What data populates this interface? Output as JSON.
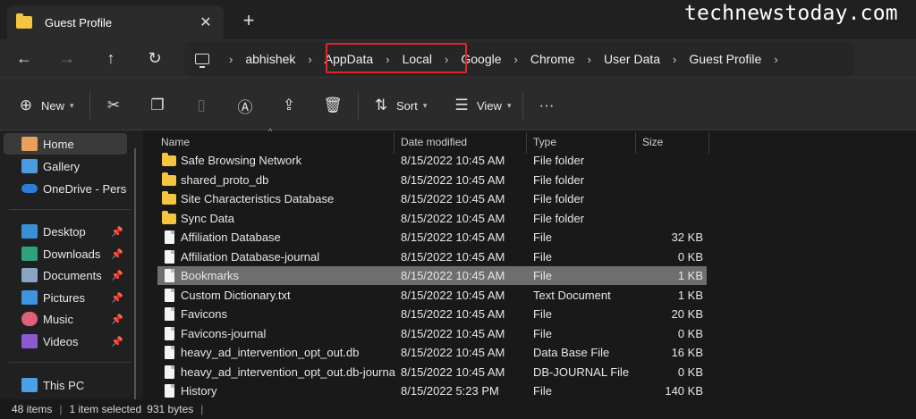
{
  "tab": {
    "title": "Guest Profile",
    "close": "✕",
    "new_tab": "+"
  },
  "watermark": "technewstoday.com",
  "nav": {
    "back": "←",
    "forward": "→",
    "up": "↑",
    "refresh": "↻"
  },
  "breadcrumbs": [
    "abhishek",
    "AppData",
    "Local",
    "Google",
    "Chrome",
    "User Data",
    "Guest Profile"
  ],
  "breadcrumb_sep": "›",
  "highlight_color": "#e0252b",
  "commands": {
    "new_label": "New",
    "sort_label": "Sort",
    "view_label": "View",
    "more": "···"
  },
  "sidebar": {
    "items": [
      {
        "label": "Home",
        "icon": "home-icon"
      },
      {
        "label": "Gallery",
        "icon": "gallery-icon"
      },
      {
        "label": "OneDrive - Person",
        "icon": "onedrive-icon"
      },
      {
        "label": "Desktop",
        "icon": "desktop-icon"
      },
      {
        "label": "Downloads",
        "icon": "downloads-icon"
      },
      {
        "label": "Documents",
        "icon": "documents-icon"
      },
      {
        "label": "Pictures",
        "icon": "pictures-icon"
      },
      {
        "label": "Music",
        "icon": "music-icon"
      },
      {
        "label": "Videos",
        "icon": "videos-icon"
      },
      {
        "label": "This PC",
        "icon": "this-pc-icon"
      }
    ]
  },
  "columns": {
    "name": "Name",
    "date": "Date modified",
    "type": "Type",
    "size": "Size"
  },
  "files": [
    {
      "name": "Safe Browsing Network",
      "date": "8/15/2022 10:45 AM",
      "type": "File folder",
      "size": "",
      "kind": "folder"
    },
    {
      "name": "shared_proto_db",
      "date": "8/15/2022 10:45 AM",
      "type": "File folder",
      "size": "",
      "kind": "folder"
    },
    {
      "name": "Site Characteristics Database",
      "date": "8/15/2022 10:45 AM",
      "type": "File folder",
      "size": "",
      "kind": "folder"
    },
    {
      "name": "Sync Data",
      "date": "8/15/2022 10:45 AM",
      "type": "File folder",
      "size": "",
      "kind": "folder"
    },
    {
      "name": "Affiliation Database",
      "date": "8/15/2022 10:45 AM",
      "type": "File",
      "size": "32 KB",
      "kind": "file"
    },
    {
      "name": "Affiliation Database-journal",
      "date": "8/15/2022 10:45 AM",
      "type": "File",
      "size": "0 KB",
      "kind": "file"
    },
    {
      "name": "Bookmarks",
      "date": "8/15/2022 10:45 AM",
      "type": "File",
      "size": "1 KB",
      "kind": "file",
      "selected": true
    },
    {
      "name": "Custom Dictionary.txt",
      "date": "8/15/2022 10:45 AM",
      "type": "Text Document",
      "size": "1 KB",
      "kind": "file"
    },
    {
      "name": "Favicons",
      "date": "8/15/2022 10:45 AM",
      "type": "File",
      "size": "20 KB",
      "kind": "file"
    },
    {
      "name": "Favicons-journal",
      "date": "8/15/2022 10:45 AM",
      "type": "File",
      "size": "0 KB",
      "kind": "file"
    },
    {
      "name": "heavy_ad_intervention_opt_out.db",
      "date": "8/15/2022 10:45 AM",
      "type": "Data Base File",
      "size": "16 KB",
      "kind": "file"
    },
    {
      "name": "heavy_ad_intervention_opt_out.db-journal",
      "date": "8/15/2022 10:45 AM",
      "type": "DB-JOURNAL File",
      "size": "0 KB",
      "kind": "file"
    },
    {
      "name": "History",
      "date": "8/15/2022 5:23 PM",
      "type": "File",
      "size": "140 KB",
      "kind": "file"
    }
  ],
  "status": {
    "items": "48 items",
    "selected": "1 item selected",
    "size": "931 bytes",
    "sep": "|"
  }
}
